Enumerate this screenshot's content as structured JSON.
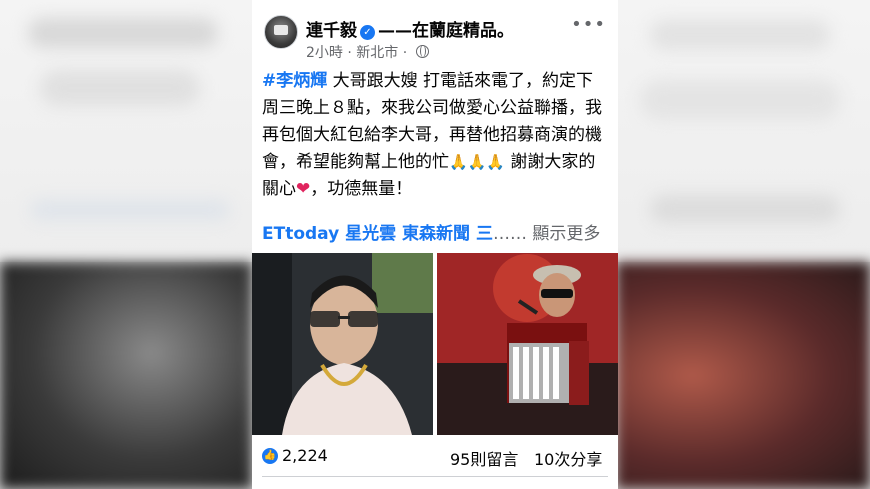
{
  "post": {
    "author_name": "連千毅",
    "feeling_text": "——在蘭庭精品。",
    "time_text": "2小時 · 新北市 · ",
    "hashtag": "#李炳輝",
    "body_line1": " 大哥跟大嫂 打電話來電了，約定下周三晚上８點，來我公司做愛心公益聯播，我再包個大紅包給李大哥，再替他招募商演的機會，希望能夠幫上他的忙",
    "pray_icons": "🙏🙏🙏",
    "body_line2": " 謝謝大家的關心",
    "heart": "❤",
    "body_line3": "，功德無量！",
    "link_text": "ETtoday 星光雲 東森新聞 三",
    "ellipsis": "……",
    "see_more": " 顯示更多"
  },
  "stats": {
    "likes": "2,224",
    "comments": "95則留言",
    "shares": "10次分享"
  },
  "icons": {
    "verified": "verified-badge-icon",
    "globe": "globe-icon",
    "more": "more-options-icon",
    "like": "like-thumb-icon"
  },
  "colors": {
    "accent": "#1877f2",
    "heart": "#e0245e"
  }
}
